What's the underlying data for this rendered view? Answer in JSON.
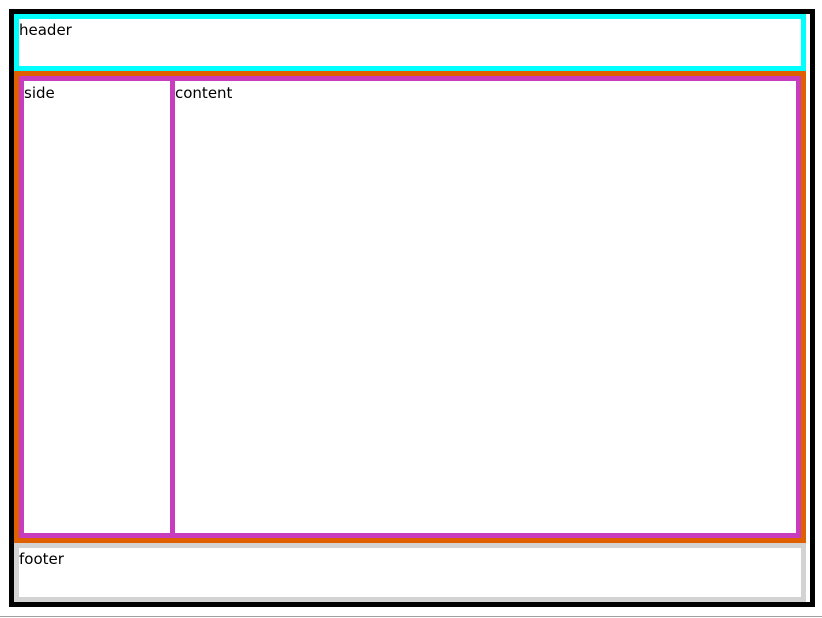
{
  "header": {
    "label": "header"
  },
  "side": {
    "label": "side"
  },
  "content": {
    "label": "content"
  },
  "footer": {
    "label": "footer"
  },
  "colors": {
    "outer": "#000000",
    "header": "#00ffff",
    "main": "#e06000",
    "panels": "#c83cbe",
    "footer": "#d3d3d3"
  }
}
